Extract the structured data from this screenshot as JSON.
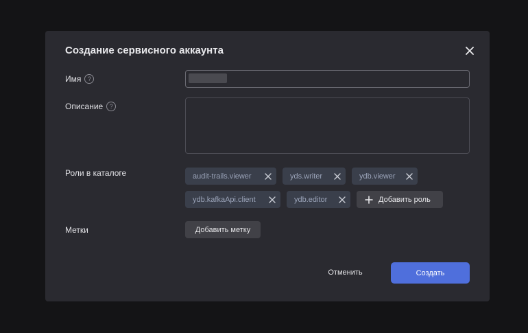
{
  "dialog": {
    "title": "Создание сервисного аккаунта"
  },
  "fields": {
    "name_label": "Имя",
    "name_value": "",
    "description_label": "Описание",
    "description_value": "",
    "roles_label": "Роли в каталоге",
    "labels_label": "Метки",
    "help_glyph": "?"
  },
  "roles": [
    {
      "label": "audit-trails.viewer"
    },
    {
      "label": "yds.writer"
    },
    {
      "label": "ydb.viewer"
    },
    {
      "label": "ydb.kafkaApi.client"
    },
    {
      "label": "ydb.editor"
    }
  ],
  "actions": {
    "add_role": "Добавить роль",
    "add_label": "Добавить метку",
    "cancel": "Отменить",
    "create": "Создать"
  },
  "icons": {
    "close": "close-icon",
    "help": "help-circle-icon",
    "remove": "remove-role-icon",
    "add": "plus-icon"
  },
  "colors": {
    "backdrop": "#141416",
    "dialog_bg": "#2a2a30",
    "chip_bg": "#3a3f4b",
    "primary": "#4f6fdc"
  }
}
